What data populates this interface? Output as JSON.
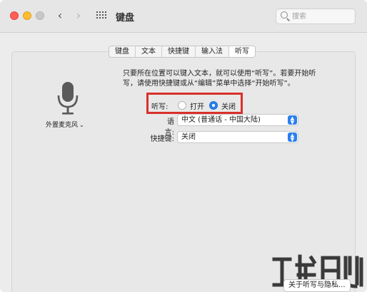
{
  "window": {
    "title": "键盘",
    "search_placeholder": "搜索"
  },
  "tabs": [
    {
      "label": "键盘",
      "active": false
    },
    {
      "label": "文本",
      "active": false
    },
    {
      "label": "快捷键",
      "active": false
    },
    {
      "label": "输入法",
      "active": false
    },
    {
      "label": "听写",
      "active": true
    }
  ],
  "microphone": {
    "icon": "microphone-icon",
    "label": "外置麦克风"
  },
  "dictation": {
    "description": "只要所在位置可以键入文本，就可以使用“听写”。若要开始听写，请使用快捷键或从“编辑”菜单中选择“开始听写”。",
    "label": "听写:",
    "option_on": "打开",
    "option_off": "关闭",
    "selected": "关闭"
  },
  "language": {
    "label": "语言:",
    "value": "中文 (普通话 - 中国大陆)"
  },
  "shortcut": {
    "label": "快捷键:",
    "value": "关闭"
  },
  "about_button": "关于听写与隐私...",
  "colors": {
    "accent": "#2a7ff0",
    "highlight": "#d9302c"
  }
}
